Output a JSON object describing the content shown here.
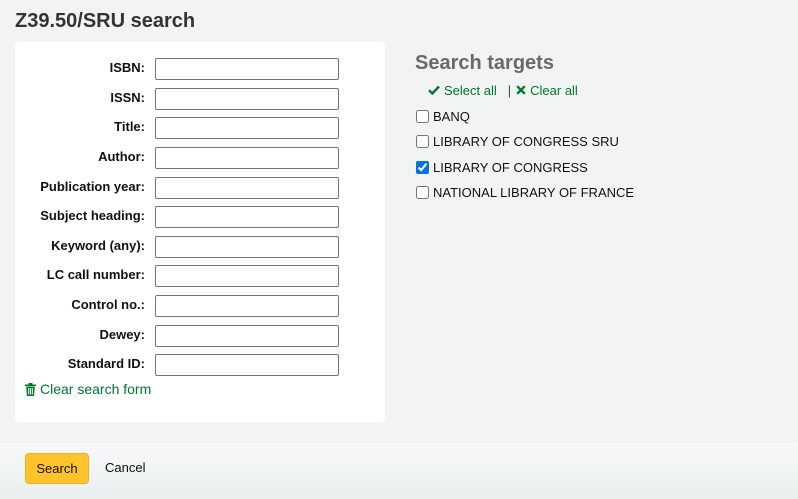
{
  "page": {
    "title": "Z39.50/SRU search"
  },
  "form": {
    "fields": [
      {
        "label": "ISBN:",
        "value": ""
      },
      {
        "label": "ISSN:",
        "value": ""
      },
      {
        "label": "Title:",
        "value": ""
      },
      {
        "label": "Author:",
        "value": ""
      },
      {
        "label": "Publication year:",
        "value": ""
      },
      {
        "label": "Subject heading:",
        "value": ""
      },
      {
        "label": "Keyword (any):",
        "value": ""
      },
      {
        "label": "LC call number:",
        "value": ""
      },
      {
        "label": "Control no.:",
        "value": ""
      },
      {
        "label": "Dewey:",
        "value": ""
      },
      {
        "label": "Standard ID:",
        "value": ""
      }
    ],
    "clear_label": "Clear search form",
    "clear_icon": "trash-icon"
  },
  "targets": {
    "title": "Search targets",
    "select_all_label": "Select all",
    "clear_all_label": "Clear all",
    "separator": "|",
    "items": [
      {
        "label": "BANQ",
        "checked": false
      },
      {
        "label": "LIBRARY OF CONGRESS SRU",
        "checked": false
      },
      {
        "label": "LIBRARY OF CONGRESS",
        "checked": true
      },
      {
        "label": "NATIONAL LIBRARY OF FRANCE",
        "checked": false
      }
    ]
  },
  "footer": {
    "search_label": "Search",
    "cancel_label": "Cancel"
  },
  "colors": {
    "accent_green": "#00762f",
    "button_yellow": "#ffc32b",
    "checkbox_blue": "#0a6fe0"
  }
}
